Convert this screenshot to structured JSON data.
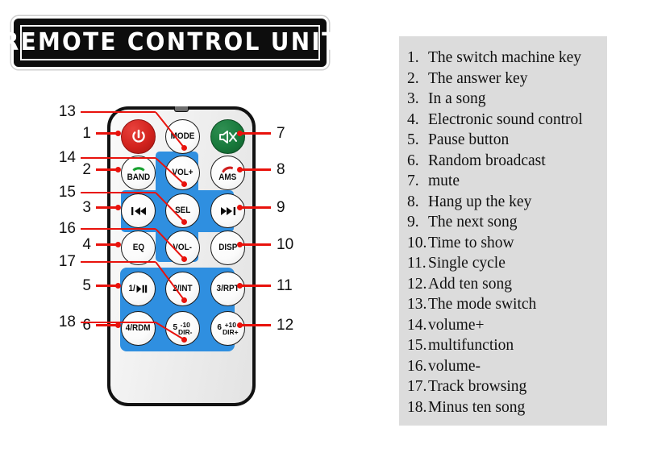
{
  "title": {
    "text": "REMOTE CONTROL UNIT"
  },
  "legend": {
    "items": [
      {
        "num": "1.",
        "label": "The switch machine key"
      },
      {
        "num": "2.",
        "label": "The answer key"
      },
      {
        "num": "3.",
        "label": "In a song"
      },
      {
        "num": "4.",
        "label": "Electronic sound control"
      },
      {
        "num": "5.",
        "label": "Pause button"
      },
      {
        "num": "6.",
        "label": "Random broadcast"
      },
      {
        "num": "7.",
        "label": "mute"
      },
      {
        "num": "8.",
        "label": "Hang up the key"
      },
      {
        "num": "9.",
        "label": "The next song"
      },
      {
        "num": "10.",
        "label": "Time to show"
      },
      {
        "num": "11.",
        "label": "Single cycle"
      },
      {
        "num": "12.",
        "label": "Add ten song"
      },
      {
        "num": "13.",
        "label": "The mode switch"
      },
      {
        "num": "14.",
        "label": "volume+"
      },
      {
        "num": "15.",
        "label": "multifunction"
      },
      {
        "num": "16.",
        "label": "volume-"
      },
      {
        "num": "17.",
        "label": "Track browsing"
      },
      {
        "num": "18.",
        "label": "Minus ten song"
      }
    ]
  },
  "remote": {
    "buttons": {
      "power": {
        "label": "",
        "icon": "power-icon"
      },
      "mode": {
        "label": "MODE"
      },
      "mute": {
        "label": "",
        "icon": "speaker-mute-icon"
      },
      "band": {
        "label": "BAND",
        "icon": "phone-answer-icon"
      },
      "volup": {
        "label": "VOL+"
      },
      "ams": {
        "label": "AMS",
        "icon": "phone-hangup-icon"
      },
      "prev": {
        "label": "",
        "icon": "previous-track-icon"
      },
      "sel": {
        "label": "SEL"
      },
      "next": {
        "label": "",
        "icon": "next-track-icon"
      },
      "eq": {
        "label": "EQ"
      },
      "voldown": {
        "label": "VOL-"
      },
      "disp": {
        "label": "DISP"
      },
      "pause": {
        "label": "1/",
        "icon": "pause-play-icon"
      },
      "int": {
        "label": "2/INT"
      },
      "rpt": {
        "label": "3/RPT"
      },
      "rdm": {
        "label": "4/RDM"
      },
      "dirminus": {
        "digit": "5",
        "line1": "-10",
        "line2": "DIR-"
      },
      "dirplus": {
        "digit": "6",
        "line1": "+10",
        "line2": "DIR+"
      }
    }
  },
  "callouts": {
    "left_inner": [
      "1",
      "2",
      "3",
      "4",
      "5",
      "6"
    ],
    "left_outer": [
      "13",
      "14",
      "15",
      "16",
      "17",
      "18"
    ],
    "right": [
      "7",
      "8",
      "9",
      "10",
      "11",
      "12"
    ]
  },
  "colors": {
    "accent_red": "#e8120c",
    "panel_gray": "#dcdcdc",
    "blue": "#2f8fe0",
    "power_red": "#d2231e",
    "mute_green": "#187a3c"
  }
}
